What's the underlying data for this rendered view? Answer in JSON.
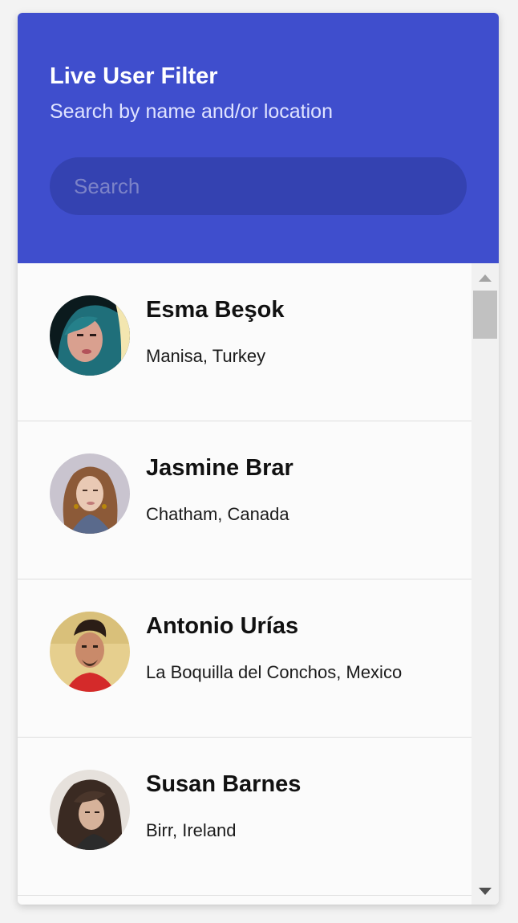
{
  "header": {
    "title": "Live User Filter",
    "subtitle": "Search by name and/or location",
    "search_placeholder": "Search",
    "background_color": "#3f4ecd"
  },
  "users": [
    {
      "name": "Esma Beşok",
      "location": "Manisa, Turkey",
      "avatar": "user-photo"
    },
    {
      "name": "Jasmine Brar",
      "location": "Chatham, Canada",
      "avatar": "user-photo"
    },
    {
      "name": "Antonio Urías",
      "location": "La Boquilla del Conchos, Mexico",
      "avatar": "user-photo"
    },
    {
      "name": "Susan Barnes",
      "location": "Birr, Ireland",
      "avatar": "user-photo"
    }
  ],
  "scrollbar": {
    "up_icon": "arrow-up-icon",
    "down_icon": "arrow-down-icon",
    "position": 0
  }
}
